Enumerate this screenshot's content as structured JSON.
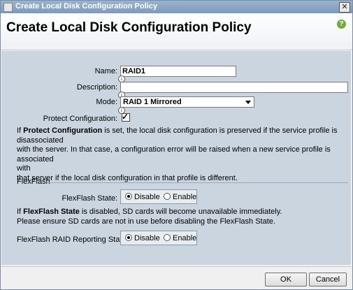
{
  "window": {
    "title": "Create Local Disk Configuration Policy",
    "close_glyph": "✕"
  },
  "header": {
    "title": "Create Local Disk Configuration Policy",
    "help_glyph": "?"
  },
  "form": {
    "name_label": "Name:",
    "name_value": "RAID1",
    "description_label": "Description:",
    "description_value": "",
    "mode_label": "Mode:",
    "mode_value": "RAID 1 Mirrored",
    "protect_label": "Protect Configuration:",
    "protect_checked": true,
    "info_glyph": "i"
  },
  "protect_note": {
    "l1_pre": "If ",
    "l1_bold": "Protect Configuration",
    "l1_post": " is set, the local disk configuration is preserved if the service profile is",
    "l2": "disassociated",
    "l3": "with the server. In that case, a configuration error will be raised when a new service profile is associated",
    "l4": "with",
    "l5": "that server if the local disk configuration in that profile is different."
  },
  "flexflash": {
    "section_label": "FlexFlash",
    "state_label": "FlexFlash State:",
    "state_options": [
      "Disable",
      "Enable"
    ],
    "state_selected": "Disable",
    "note_pre": "If ",
    "note_bold": "FlexFlash State",
    "note_post": " is disabled, SD cards will become unavailable immediately.",
    "note_l2": "Please ensure SD cards are not in use before disabling the FlexFlash State.",
    "raid_label": "FlexFlash RAID Reporting State:",
    "raid_options": [
      "Disable",
      "Enable"
    ],
    "raid_selected": "Disable"
  },
  "buttons": {
    "ok": "OK",
    "cancel": "Cancel"
  }
}
